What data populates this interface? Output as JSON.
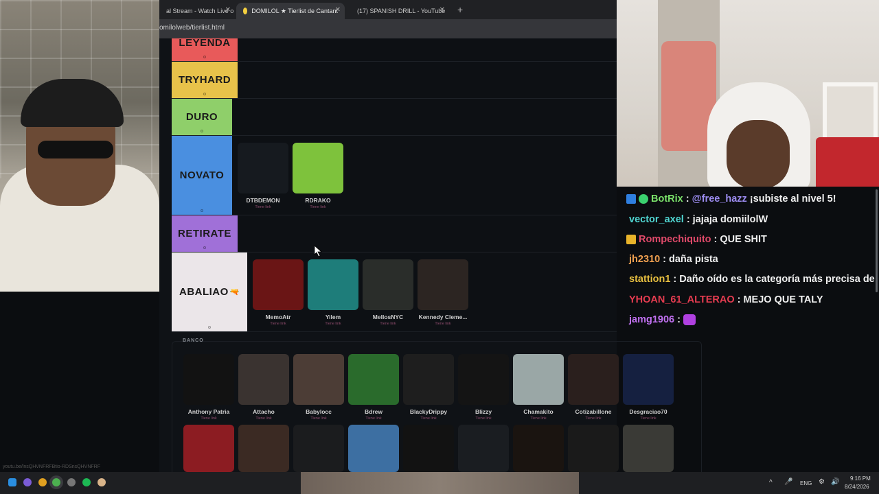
{
  "browser": {
    "tabs": [
      {
        "label": "al Stream - Watch Live o",
        "favicon_color": "#9146ff"
      },
      {
        "label": "DOMILOL ★ Tierlist de Cantant",
        "favicon_color": "#f4d03f"
      },
      {
        "label": "(17) SPANISH DRILL - YouTube",
        "favicon_color": "#ff0000"
      }
    ],
    "new_tab_icon": "plus",
    "url": "omilolweb/tierlist.html",
    "status_url": "youtu.be/lnsQHVNFRFBtio-RDSnsQHVNFRF"
  },
  "tiers": [
    {
      "label": "LEYENDA",
      "color": "#e85a5a",
      "cards": []
    },
    {
      "label": "TRYHARD",
      "color": "#e8c24a",
      "cards": []
    },
    {
      "label": "DURO",
      "color": "#8fcf6a",
      "cards": []
    },
    {
      "label": "NOVATO",
      "color": "#4a8fe0",
      "cards": [
        {
          "name": "DTBDEMON",
          "sub": "Tiene link",
          "color": "#161a1f"
        },
        {
          "name": "RDRAKO",
          "sub": "Tiene link",
          "color": "#7ec23c"
        }
      ]
    },
    {
      "label": "RETIRATE",
      "color": "#a070d8",
      "cards": []
    },
    {
      "label": "ABALIAO",
      "color": "#ebe6e9",
      "emoji": "🔫",
      "cards": [
        {
          "name": "MemoAtr",
          "sub": "Tiene link",
          "color": "#6a1515"
        },
        {
          "name": "Yilem",
          "sub": "Tiene link",
          "color": "#1e7d7a"
        },
        {
          "name": "MellosNYC",
          "sub": "Tiene link",
          "color": "#2a2d2a"
        },
        {
          "name": "Kennedy Cleme...",
          "sub": "Tiene link",
          "color": "#2c2522"
        }
      ]
    }
  ],
  "banco": {
    "title": "BANCO",
    "row1": [
      {
        "name": "Anthony Patria",
        "sub": "Tiene link",
        "color": "#121212"
      },
      {
        "name": "Attacho",
        "sub": "Tiene link",
        "color": "#3a3330"
      },
      {
        "name": "Babylocc",
        "sub": "Tiene link",
        "color": "#4c3d36"
      },
      {
        "name": "Bdrew",
        "sub": "Tiene link",
        "color": "#2a6b2c"
      },
      {
        "name": "BlackyDrippy",
        "sub": "Tiene link",
        "color": "#1e1e1e"
      },
      {
        "name": "Blizzy",
        "sub": "Tiene link",
        "color": "#141414"
      },
      {
        "name": "Chamakito",
        "sub": "Tiene link",
        "color": "#9aa7a6"
      },
      {
        "name": "Cotizabillone",
        "sub": "Tiene link",
        "color": "#2a1f1d"
      },
      {
        "name": "Desgraciao70",
        "sub": "Tiene link",
        "color": "#152040"
      }
    ],
    "row2": [
      {
        "name": "",
        "color": "#8c1c22"
      },
      {
        "name": "",
        "color": "#3b2a23"
      },
      {
        "name": "",
        "color": "#1b1c1e"
      },
      {
        "name": "",
        "color": "#3d6fa2"
      },
      {
        "name": "",
        "color": "#121212"
      },
      {
        "name": "",
        "color": "#1a1d21"
      },
      {
        "name": "",
        "color": "#1a1410"
      },
      {
        "name": "",
        "color": "#1a1a1a"
      },
      {
        "name": "",
        "color": "#3a3a36"
      }
    ]
  },
  "chat": {
    "messages": [
      {
        "badge": "prime",
        "badge2": "verified",
        "user": "BotRix",
        "user_color": "#7be26b",
        "mention": "@free_hazz",
        "text": "¡subiste al nivel 5!"
      },
      {
        "user": "vector_axel",
        "user_color": "#4fd4d0",
        "text": "jajaja domiilolW"
      },
      {
        "badge": "crown",
        "user": "Rompechiquito",
        "user_color": "#e04a6a",
        "text": "QUE SHIT"
      },
      {
        "user": "jh2310",
        "user_color": "#f0a050",
        "text": "daña pista"
      },
      {
        "user": "stattion1",
        "user_color": "#e8c040",
        "text": "Daño oído es la categoría más precisa de"
      },
      {
        "user": "YHOAN_61_ALTERAO",
        "user_color": "#e63c50",
        "text": "MEJO QUE TALY"
      },
      {
        "user": "jamg1906",
        "user_color": "#c070f0",
        "text": "",
        "emote": "emote-icon"
      }
    ]
  },
  "taskbar": {
    "lang": "ENG",
    "time": "9:16 PM",
    "date": "8/24/2026"
  }
}
